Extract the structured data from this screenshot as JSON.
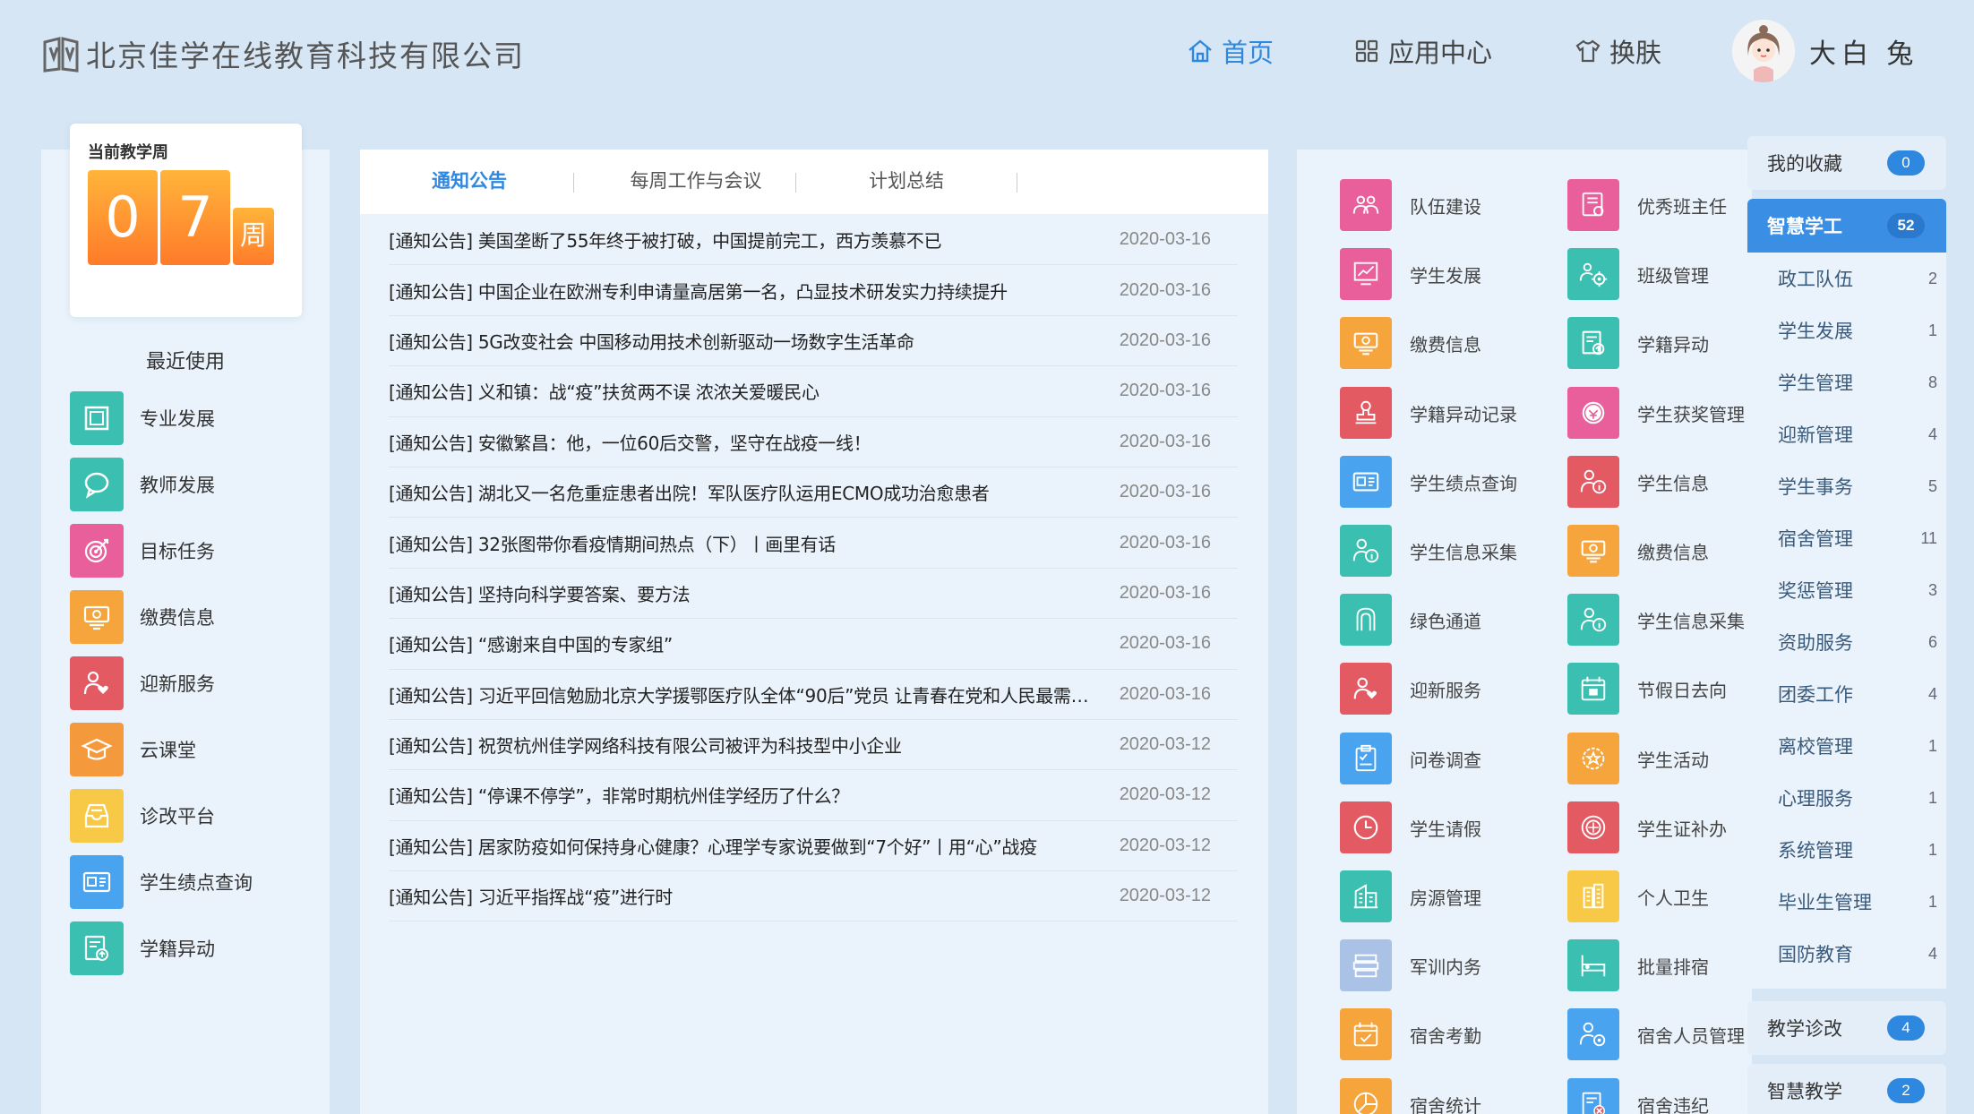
{
  "header": {
    "company": "北京佳学在线教育科技有限公司",
    "nav": {
      "home": "首页",
      "apps": "应用中心",
      "skin": "换肤"
    },
    "user": "大白 兔",
    "accent": "#2f88e0"
  },
  "week": {
    "label": "当前教学周",
    "d1": "0",
    "d2": "7",
    "unit": "周"
  },
  "recent": {
    "title": "最近使用",
    "items": [
      {
        "label": "专业发展",
        "icon": "square-frame-icon",
        "color": "#3bbfb0"
      },
      {
        "label": "教师发展",
        "icon": "chat-bubble-icon",
        "color": "#3bbfb0"
      },
      {
        "label": "目标任务",
        "icon": "target-icon",
        "color": "#e85f9c"
      },
      {
        "label": "缴费信息",
        "icon": "payment-icon",
        "color": "#f5a53c"
      },
      {
        "label": "迎新服务",
        "icon": "welcome-icon",
        "color": "#e45a63"
      },
      {
        "label": "云课堂",
        "icon": "graduation-cap-icon",
        "color": "#f59a3c"
      },
      {
        "label": "诊改平台",
        "icon": "inbox-tray-icon",
        "color": "#f7c946"
      },
      {
        "label": "学生绩点查询",
        "icon": "id-card-icon",
        "color": "#4aa3ee"
      },
      {
        "label": "学籍异动",
        "icon": "record-change-icon",
        "color": "#3bbfb0"
      }
    ]
  },
  "tabs": [
    "通知公告",
    "每周工作与会议",
    "计划总结"
  ],
  "news": [
    {
      "title": "[通知公告] 美国垄断了55年终于被打破，中国提前完工，西方羡慕不已",
      "date": "2020-03-16"
    },
    {
      "title": "[通知公告] 中国企业在欧洲专利申请量高居第一名，凸显技术研发实力持续提升",
      "date": "2020-03-16"
    },
    {
      "title": "[通知公告] 5G改变社会 中国移动用技术创新驱动一场数字生活革命",
      "date": "2020-03-16"
    },
    {
      "title": "[通知公告] 义和镇：战“疫”扶贫两不误 浓浓关爱暖民心",
      "date": "2020-03-16"
    },
    {
      "title": "[通知公告] 安徽繁昌：他，一位60后交警，坚守在战疫一线！",
      "date": "2020-03-16"
    },
    {
      "title": "[通知公告] 湖北又一名危重症患者出院！军队医疗队运用ECMO成功治愈患者",
      "date": "2020-03-16"
    },
    {
      "title": "[通知公告] 32张图带你看疫情期间热点（下）丨画里有话",
      "date": "2020-03-16"
    },
    {
      "title": "[通知公告] 坚持向科学要答案、要方法",
      "date": "2020-03-16"
    },
    {
      "title": "[通知公告] “感谢来自中国的专家组”",
      "date": "2020-03-16"
    },
    {
      "title": "[通知公告] 习近平回信勉励北京大学援鄂医疗队全体“90后”党员 让青春在党和人民最需要的地方绽放绚丽之花",
      "date": "2020-03-16"
    },
    {
      "title": "[通知公告] 祝贺杭州佳学网络科技有限公司被评为科技型中小企业",
      "date": "2020-03-12"
    },
    {
      "title": "[通知公告] “停课不停学”，非常时期杭州佳学经历了什么？",
      "date": "2020-03-12"
    },
    {
      "title": "[通知公告] 居家防疫如何保持身心健康？心理学专家说要做到“7个好”丨用“心”战疫",
      "date": "2020-03-12"
    },
    {
      "title": "[通知公告] 习近平指挥战“疫”进行时",
      "date": "2020-03-12"
    }
  ],
  "apps": {
    "col1": [
      {
        "label": "队伍建设",
        "icon": "team-icon",
        "color": "#e85f9c"
      },
      {
        "label": "学生发展",
        "icon": "growth-chart-icon",
        "color": "#e85f9c"
      },
      {
        "label": "缴费信息",
        "icon": "payment-icon",
        "color": "#f5a53c"
      },
      {
        "label": "学籍异动记录",
        "icon": "stamp-icon",
        "color": "#e45a63"
      },
      {
        "label": "学生绩点查询",
        "icon": "id-card-icon",
        "color": "#4aa3ee"
      },
      {
        "label": "学生信息采集",
        "icon": "info-user-icon",
        "color": "#3bbfb0"
      },
      {
        "label": "绿色通道",
        "icon": "arch-door-icon",
        "color": "#3bbfb0"
      },
      {
        "label": "迎新服务",
        "icon": "welcome-icon",
        "color": "#e45a63"
      },
      {
        "label": "问卷调查",
        "icon": "clipboard-icon",
        "color": "#4aa3ee"
      },
      {
        "label": "学生请假",
        "icon": "clock-icon",
        "color": "#e45a63"
      },
      {
        "label": "房源管理",
        "icon": "building-icon",
        "color": "#3bbfb0"
      },
      {
        "label": "军训内务",
        "icon": "bed-stack-icon",
        "color": "#a9c2e6"
      },
      {
        "label": "宿舍考勤",
        "icon": "calendar-check-icon",
        "color": "#f5a53c"
      },
      {
        "label": "宿舍统计",
        "icon": "pie-chart-icon",
        "color": "#f5a53c"
      }
    ],
    "col2": [
      {
        "label": "优秀班主任",
        "icon": "certificate-icon",
        "color": "#e85f9c"
      },
      {
        "label": "班级管理",
        "icon": "group-gear-icon",
        "color": "#3bbfb0"
      },
      {
        "label": "学籍异动",
        "icon": "record-change-icon",
        "color": "#3bbfb0"
      },
      {
        "label": "学生获奖管理",
        "icon": "award-icon",
        "color": "#e85f9c"
      },
      {
        "label": "学生信息",
        "icon": "info-user-icon",
        "color": "#e45a63"
      },
      {
        "label": "缴费信息",
        "icon": "payment-icon",
        "color": "#f5a53c"
      },
      {
        "label": "学生信息采集",
        "icon": "info-user-icon",
        "color": "#3bbfb0"
      },
      {
        "label": "节假日去向",
        "icon": "holiday-calendar-icon",
        "color": "#3bbfb0"
      },
      {
        "label": "学生活动",
        "icon": "star-gear-icon",
        "color": "#f5a53c"
      },
      {
        "label": "学生证补办",
        "icon": "badge-icon",
        "color": "#e45a63"
      },
      {
        "label": "个人卫生",
        "icon": "tower-icon",
        "color": "#f7c946"
      },
      {
        "label": "批量排宿",
        "icon": "bed-icon",
        "color": "#3bbfb0"
      },
      {
        "label": "宿舍人员管理",
        "icon": "people-gear-icon",
        "color": "#4aa3ee"
      },
      {
        "label": "宿舍违纪",
        "icon": "violation-doc-icon",
        "color": "#4aa3ee"
      }
    ]
  },
  "menu": {
    "favorites": {
      "label": "我的收藏",
      "count": "0"
    },
    "smart": {
      "label": "智慧学工",
      "count": "52"
    },
    "sub": [
      {
        "label": "政工队伍",
        "count": "2"
      },
      {
        "label": "学生发展",
        "count": "1"
      },
      {
        "label": "学生管理",
        "count": "8"
      },
      {
        "label": "迎新管理",
        "count": "4"
      },
      {
        "label": "学生事务",
        "count": "5"
      },
      {
        "label": "宿舍管理",
        "count": "11"
      },
      {
        "label": "奖惩管理",
        "count": "3"
      },
      {
        "label": "资助服务",
        "count": "6"
      },
      {
        "label": "团委工作",
        "count": "4"
      },
      {
        "label": "离校管理",
        "count": "1"
      },
      {
        "label": "心理服务",
        "count": "1"
      },
      {
        "label": "系统管理",
        "count": "1"
      },
      {
        "label": "毕业生管理",
        "count": "1"
      },
      {
        "label": "国防教育",
        "count": "4"
      }
    ],
    "diag": {
      "label": "教学诊改",
      "count": "4"
    },
    "teach": {
      "label": "智慧教学",
      "count": "2"
    }
  }
}
